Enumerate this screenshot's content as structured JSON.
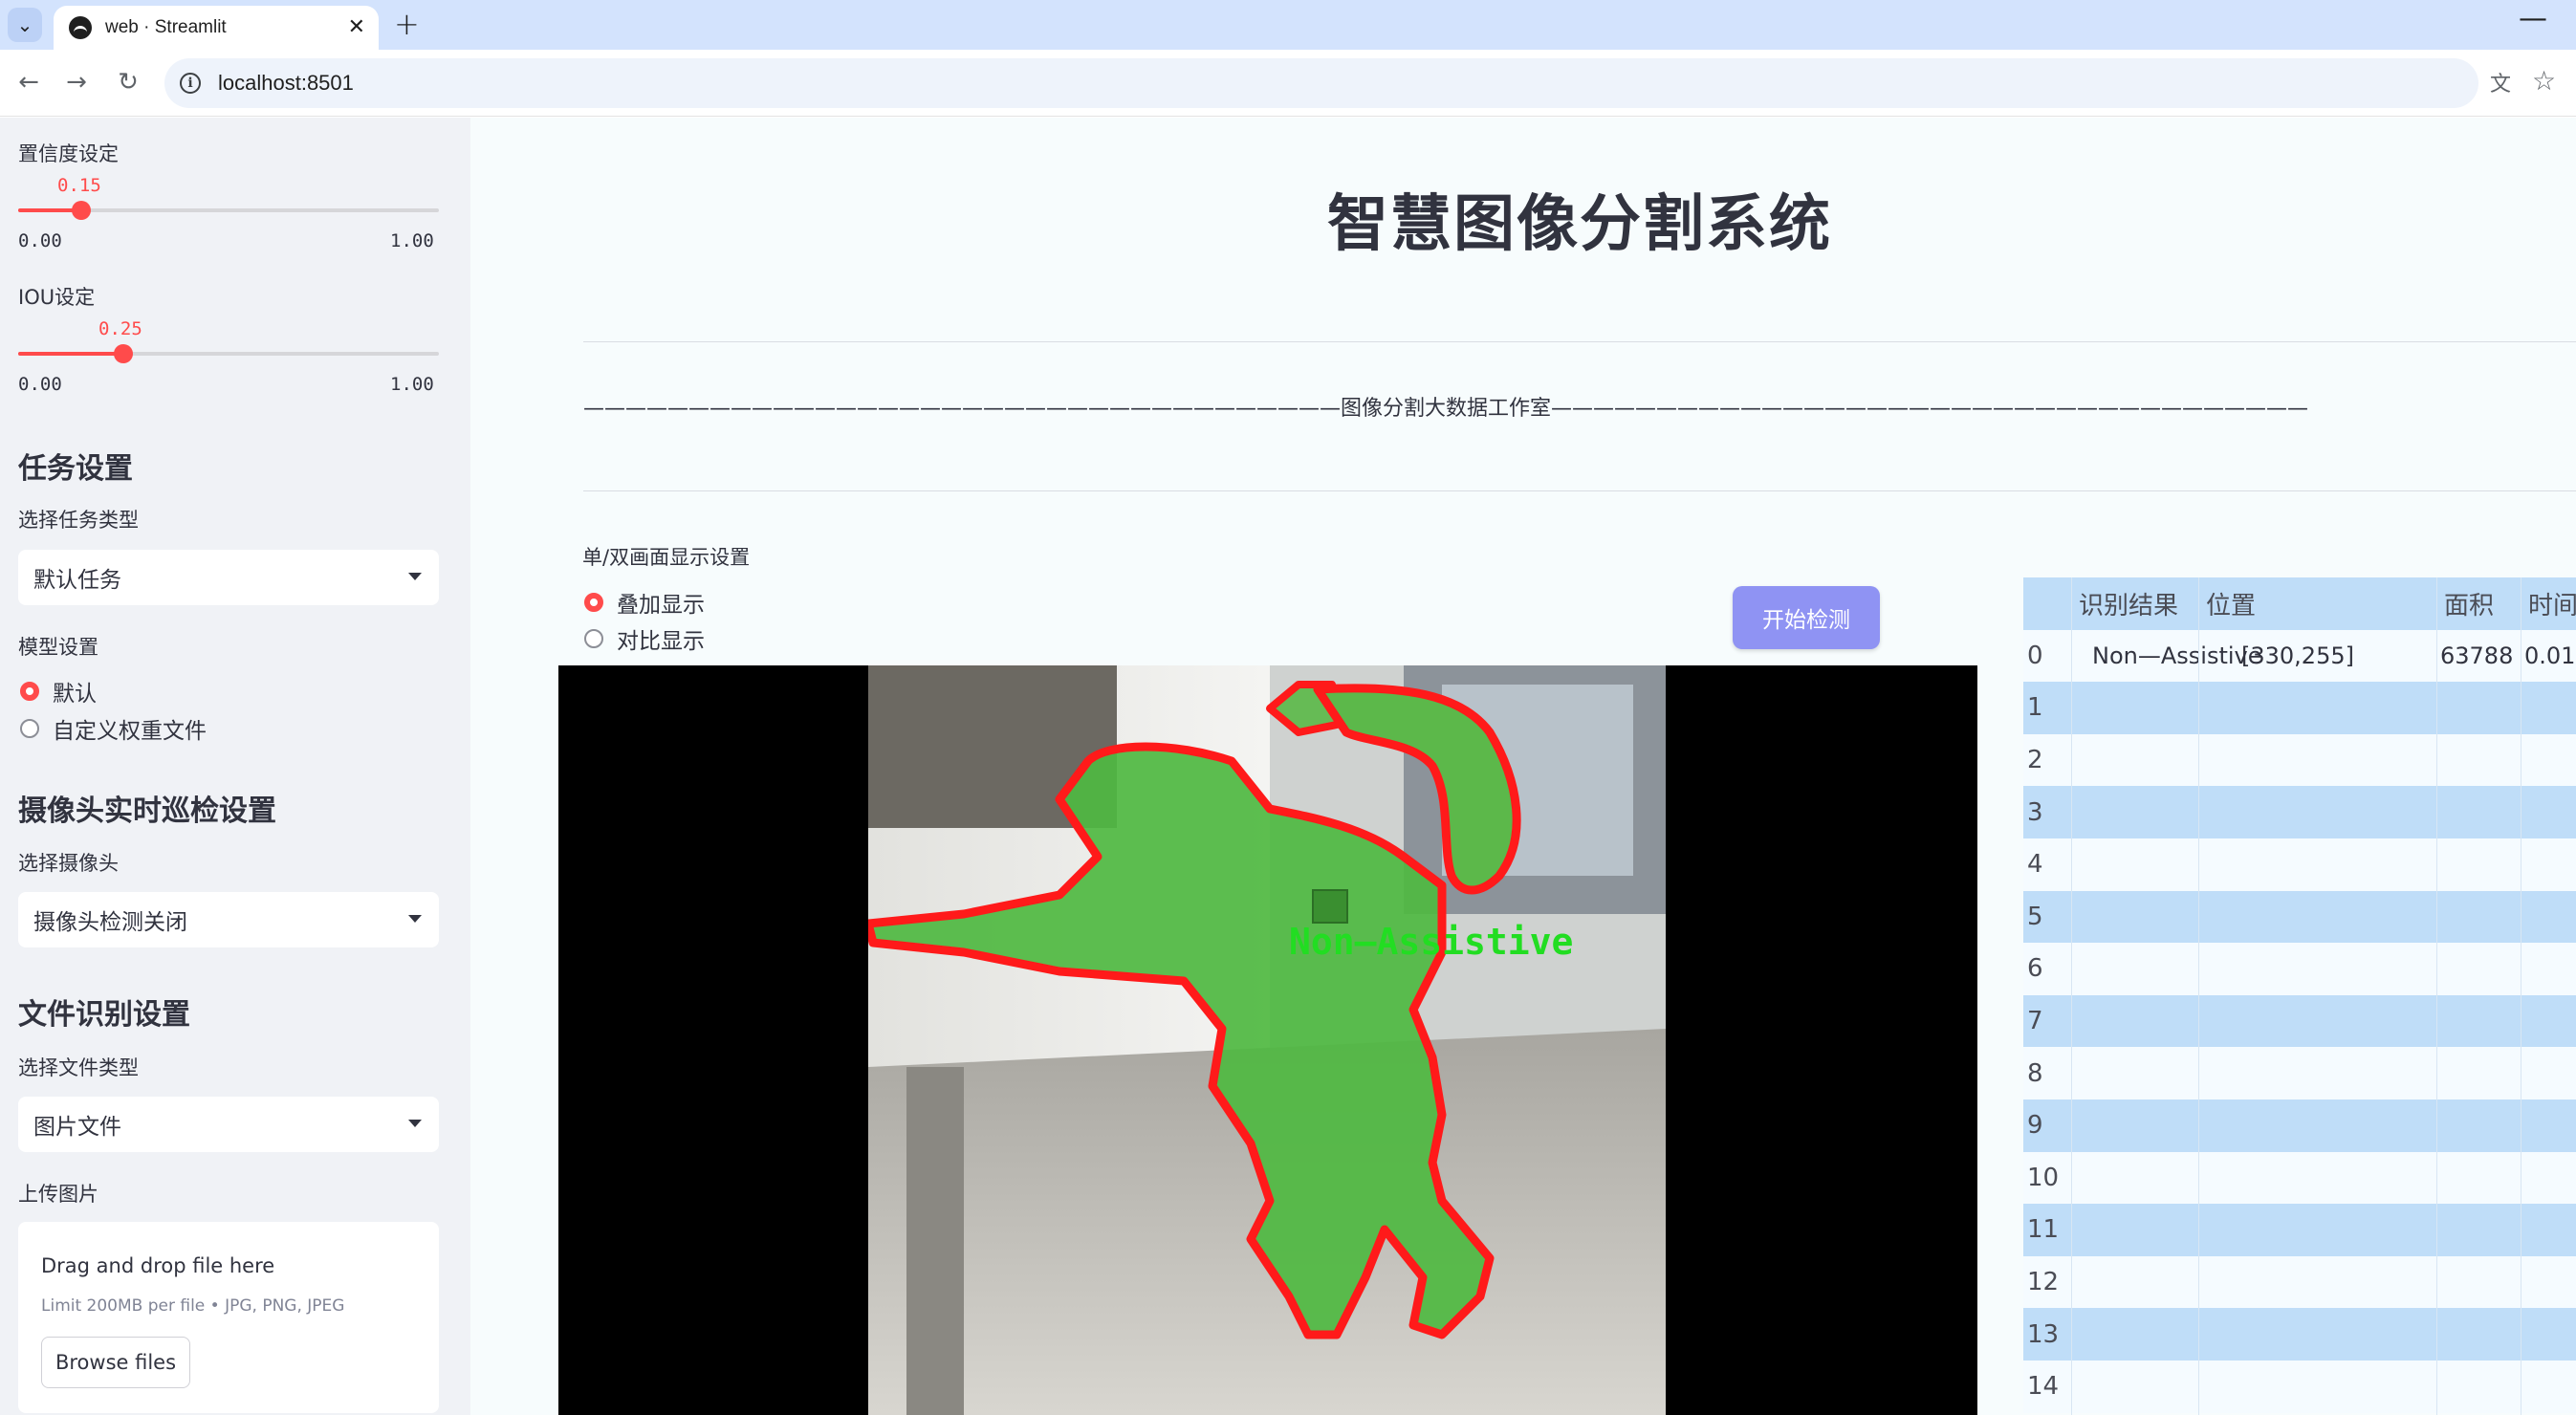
{
  "browser": {
    "tab_title": "web · Streamlit",
    "url": "localhost:8501",
    "icons": [
      "chevron-down-icon",
      "streamlit-icon",
      "close-icon",
      "plus-icon",
      "back-icon",
      "forward-icon",
      "reload-icon",
      "info-icon",
      "translate-icon",
      "star-icon",
      "minimize-icon"
    ]
  },
  "sidebar": {
    "confidence": {
      "label": "置信度设定",
      "value": 0.15,
      "value_text": "0.15",
      "min": "0.00",
      "max": "1.00"
    },
    "iou": {
      "label": "IOU设定",
      "value": 0.25,
      "value_text": "0.25",
      "min": "0.00",
      "max": "1.00"
    },
    "task_settings": {
      "heading": "任务设置",
      "select_label": "选择任务类型",
      "select_value": "默认任务"
    },
    "model_settings": {
      "label": "模型设置",
      "options": [
        "默认",
        "自定义权重文件"
      ],
      "selected": 0
    },
    "camera_settings": {
      "heading": "摄像头实时巡检设置",
      "select_label": "选择摄像头",
      "select_value": "摄像头检测关闭"
    },
    "file_settings": {
      "heading": "文件识别设置",
      "select_label": "选择文件类型",
      "select_value": "图片文件",
      "upload_label": "上传图片",
      "upload_title": "Drag and drop file here",
      "upload_limit": "Limit 200MB per file • JPG, PNG, JPEG",
      "browse_button": "Browse files"
    }
  },
  "main": {
    "title": "智慧图像分割系统",
    "studio_line": "————————————————————————————————————图像分割大数据工作室————————————————————————————————————",
    "display_mode": {
      "label": "单/双画面显示设置",
      "options": [
        "叠加显示",
        "对比显示"
      ],
      "selected": 0
    },
    "start_button": "开始检测",
    "detection_label": "Non—Assistive",
    "accent_color": "#ff4b4b",
    "mask_color": "#4cbb3c",
    "outline_color": "#ff1a1a"
  },
  "results_table": {
    "columns": [
      "",
      "识别结果",
      "位置",
      "面积",
      "时间"
    ],
    "rows": [
      {
        "index": "0",
        "result": "Non—Assistive",
        "position": "[330,255]",
        "area": "63788",
        "time": "0.01"
      },
      {
        "index": "1",
        "result": "",
        "position": "",
        "area": "",
        "time": ""
      },
      {
        "index": "2",
        "result": "",
        "position": "",
        "area": "",
        "time": ""
      },
      {
        "index": "3",
        "result": "",
        "position": "",
        "area": "",
        "time": ""
      },
      {
        "index": "4",
        "result": "",
        "position": "",
        "area": "",
        "time": ""
      },
      {
        "index": "5",
        "result": "",
        "position": "",
        "area": "",
        "time": ""
      },
      {
        "index": "6",
        "result": "",
        "position": "",
        "area": "",
        "time": ""
      },
      {
        "index": "7",
        "result": "",
        "position": "",
        "area": "",
        "time": ""
      },
      {
        "index": "8",
        "result": "",
        "position": "",
        "area": "",
        "time": ""
      },
      {
        "index": "9",
        "result": "",
        "position": "",
        "area": "",
        "time": ""
      },
      {
        "index": "10",
        "result": "",
        "position": "",
        "area": "",
        "time": ""
      },
      {
        "index": "11",
        "result": "",
        "position": "",
        "area": "",
        "time": ""
      },
      {
        "index": "12",
        "result": "",
        "position": "",
        "area": "",
        "time": ""
      },
      {
        "index": "13",
        "result": "",
        "position": "",
        "area": "",
        "time": ""
      },
      {
        "index": "14",
        "result": "",
        "position": "",
        "area": "",
        "time": ""
      }
    ]
  }
}
